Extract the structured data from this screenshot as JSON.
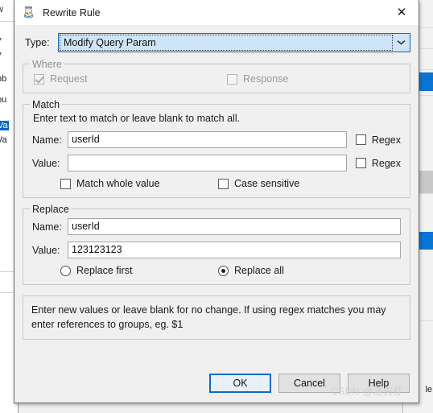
{
  "window": {
    "title": "Rewrite Rule",
    "icon": "charles-jar-icon",
    "close_label": "✕"
  },
  "type_row": {
    "label": "Type:",
    "selected": "Modify Query Param",
    "arrow_icon": "chevron-down-icon"
  },
  "where": {
    "legend": "Where",
    "enabled": false,
    "request": {
      "label": "Request",
      "checked": true
    },
    "response": {
      "label": "Response",
      "checked": false
    }
  },
  "match": {
    "legend": "Match",
    "hint": "Enter text to match or leave blank to match all.",
    "name": {
      "label": "Name:",
      "value": "userId",
      "placeholder": ""
    },
    "name_regex": {
      "label": "Regex",
      "checked": false
    },
    "value": {
      "label": "Value:",
      "value": "",
      "placeholder": ""
    },
    "value_regex": {
      "label": "Regex",
      "checked": false
    },
    "match_whole": {
      "label": "Match whole value",
      "checked": false
    },
    "case_sensitive": {
      "label": "Case sensitive",
      "checked": false
    }
  },
  "replace": {
    "legend": "Replace",
    "name": {
      "label": "Name:",
      "value": "userId",
      "placeholder": ""
    },
    "value": {
      "label": "Value:",
      "value": "123123123",
      "placeholder": ""
    },
    "replace_first": {
      "label": "Replace first",
      "selected": false
    },
    "replace_all": {
      "label": "Replace all",
      "selected": true
    }
  },
  "note": "Enter new values or leave blank for no change. If using regex matches you may enter references to groups, eg. $1",
  "buttons": {
    "ok": "OK",
    "cancel": "Cancel",
    "help": "Help"
  },
  "watermark": "CSDN @洛央虾",
  "background": {
    "left_fragments": [
      "w",
      "y",
      "y",
      "nb",
      "ou",
      "Va",
      "Va"
    ],
    "right_fragment": "le",
    "accent": "#0a74d4"
  }
}
